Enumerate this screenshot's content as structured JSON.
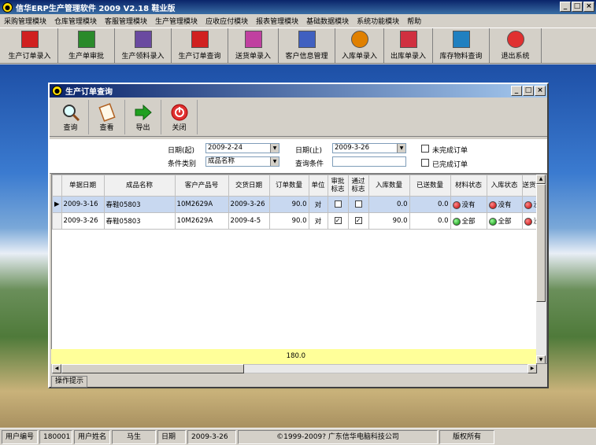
{
  "app": {
    "title": "信华ERP生产管理软件    2009 V2.18 鞋业版",
    "window_buttons": [
      "_",
      "□",
      "×"
    ]
  },
  "menu": [
    "采购管理模块",
    "仓库管理模块",
    "客服管理模块",
    "生产管理模块",
    "应收应付模块",
    "报表管理模块",
    "基础数据模块",
    "系统功能模块",
    "帮助"
  ],
  "toolbar": [
    {
      "label": "生产订单录入",
      "icon": "pdf-icon",
      "color": "#d02020"
    },
    {
      "label": "生产单审批",
      "icon": "tree-icon",
      "color": "#2a8a2a"
    },
    {
      "label": "生产领料录入",
      "icon": "note-icon",
      "color": "#6a4aa0"
    },
    {
      "label": "生产订单查询",
      "icon": "pdf-icon",
      "color": "#d02020"
    },
    {
      "label": "送货单录入",
      "icon": "flower-icon",
      "color": "#c040a0"
    },
    {
      "label": "客户信息管理",
      "icon": "document-icon",
      "color": "#4060c0"
    },
    {
      "label": "入库单录入",
      "icon": "sun-icon",
      "color": "#e08000"
    },
    {
      "label": "出库单录入",
      "icon": "flower-icon",
      "color": "#d03040"
    },
    {
      "label": "库存物料查询",
      "icon": "pen-icon",
      "color": "#2080c0"
    },
    {
      "label": "退出系统",
      "icon": "power-icon",
      "color": "#e03030"
    }
  ],
  "window": {
    "title": "生产订单查询",
    "toolbar": [
      {
        "label": "查询",
        "icon": "magnifier-icon"
      },
      {
        "label": "查看",
        "icon": "page-icon"
      },
      {
        "label": "导出",
        "icon": "arrow-right-icon"
      },
      {
        "label": "关闭",
        "icon": "power-icon"
      }
    ],
    "search": {
      "date_from_label": "日期(起)",
      "date_from": "2009-2-24",
      "date_to_label": "日期(止)",
      "date_to": "2009-3-26",
      "condition_type_label": "条件类别",
      "condition_type": "成品名称",
      "query_condition_label": "查询条件",
      "query_condition": "",
      "unfinished_label": "未完成订单",
      "finished_label": "已完成订单"
    },
    "columns": [
      "单据日期",
      "成品名称",
      "客户产品号",
      "交货日期",
      "订单数量",
      "单位",
      "审批标志",
      "通过标志",
      "入库数量",
      "已送数量",
      "材料状态",
      "入库状态",
      "送货状"
    ],
    "rows": [
      {
        "date": "2009-3-16",
        "product": "春鞋05803",
        "client_no": "10M2629A",
        "delivery": "2009-3-26",
        "qty": "90.0",
        "unit": "对",
        "approved": false,
        "passed": false,
        "in_qty": "0.0",
        "sent_qty": "0.0",
        "material_status": "没有",
        "material_color": "red",
        "in_status": "没有",
        "in_color": "red",
        "ship_status": "没",
        "ship_color": "red"
      },
      {
        "date": "2009-3-26",
        "product": "春鞋05803",
        "client_no": "10M2629A",
        "delivery": "2009-4-5",
        "qty": "90.0",
        "unit": "对",
        "approved": true,
        "passed": true,
        "in_qty": "90.0",
        "sent_qty": "0.0",
        "material_status": "全部",
        "material_color": "green",
        "in_status": "全部",
        "in_color": "green",
        "ship_status": "没",
        "ship_color": "red"
      }
    ],
    "total_qty": "180.0",
    "hint": "操作提示"
  },
  "status": {
    "user_no_label": "用户编号",
    "user_no": "180001",
    "user_name_label": "用户姓名",
    "user_name": "马生",
    "date_label": "日期",
    "date": "2009-3-26",
    "copyright": "©1999-2009?   广东信华电脑科技公司",
    "rights": "版权所有"
  }
}
